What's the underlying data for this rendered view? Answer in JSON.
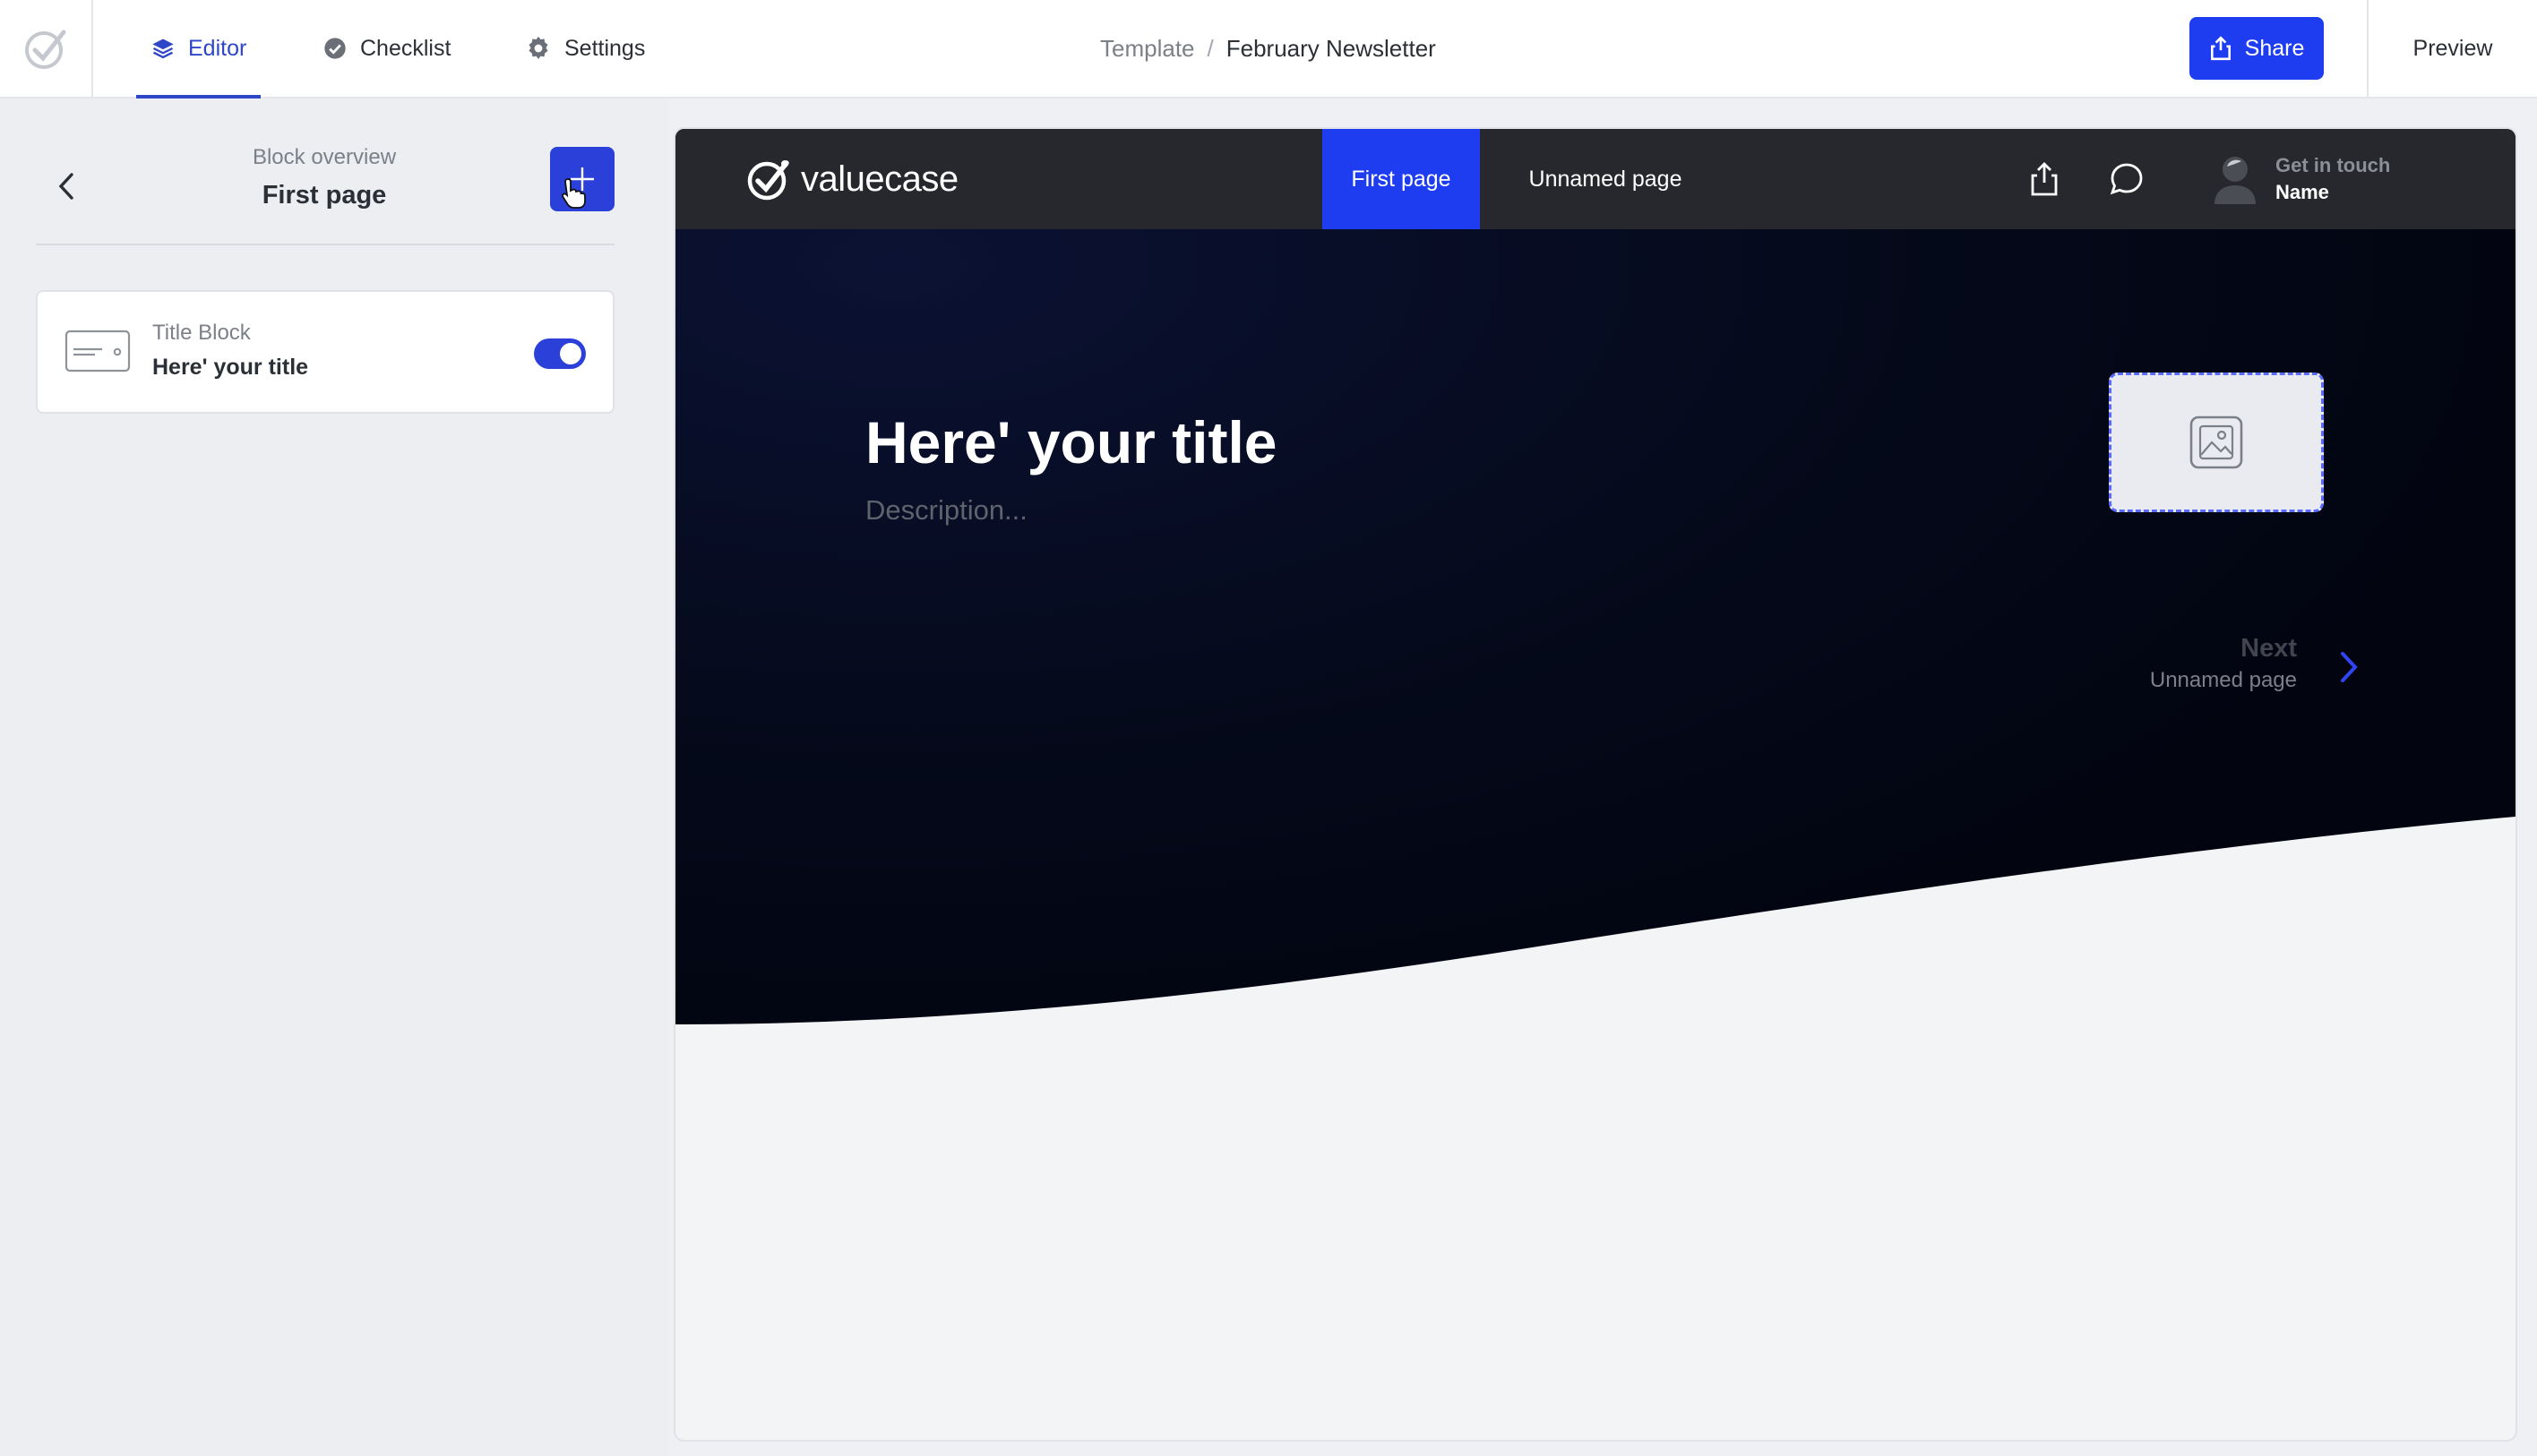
{
  "topbar": {
    "tabs": [
      {
        "label": "Editor",
        "icon": "layers-icon",
        "active": true
      },
      {
        "label": "Checklist",
        "icon": "check-circle-icon",
        "active": false
      },
      {
        "label": "Settings",
        "icon": "gear-icon",
        "active": false
      }
    ],
    "breadcrumb": {
      "parent": "Template",
      "separator": "/",
      "current": "February Newsletter"
    },
    "share_label": "Share",
    "preview_label": "Preview"
  },
  "sidebar": {
    "subtitle": "Block overview",
    "title": "First page",
    "blocks": [
      {
        "type": "Title Block",
        "name": "Here' your title",
        "enabled": true
      }
    ]
  },
  "preview": {
    "logo_text": "valuecase",
    "pages": [
      {
        "label": "First page",
        "active": true
      },
      {
        "label": "Unnamed page",
        "active": false
      }
    ],
    "contact": {
      "label": "Get in touch",
      "name": "Name"
    },
    "hero": {
      "title": "Here' your title",
      "description": "Description..."
    },
    "next": {
      "label": "Next",
      "page": "Unnamed page"
    }
  },
  "colors": {
    "accent": "#1f3df0",
    "nav_dark": "#26282d",
    "hero_dark": "#03050d"
  }
}
